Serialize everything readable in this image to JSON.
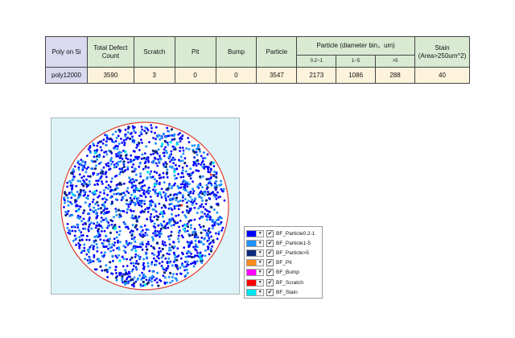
{
  "table": {
    "corner": "Poly on Si",
    "headers": {
      "total": "Total Defect Count",
      "scratch": "Scratch",
      "pit": "Pit",
      "bump": "Bump",
      "particle": "Particle",
      "particle_bin": "Particle (diameter bin，um)",
      "bin_1": "0.2~1",
      "bin_2": "1~5",
      "bin_3": ">5",
      "stain": "Stain (Area>250um^2)"
    },
    "row": {
      "label": "poly12000",
      "total": "3590",
      "scratch": "3",
      "pit": "0",
      "bump": "0",
      "particle": "3547",
      "bin_1": "2173",
      "bin_2": "1086",
      "bin_3": "288",
      "stain": "40"
    }
  },
  "colors": {
    "wafer_edge": "#e03b2e",
    "panel_bg": "#def3f7"
  },
  "legend": [
    {
      "label": "BF_Particle0.2-1",
      "color": "#0000ff",
      "checked": "✔"
    },
    {
      "label": "BF_Particle1-5",
      "color": "#1e90ff",
      "checked": "✔"
    },
    {
      "label": "BF_Particle>5",
      "color": "#0a2a7a",
      "checked": "✔"
    },
    {
      "label": "BF_Pit",
      "color": "#ff8c1a",
      "checked": "✔"
    },
    {
      "label": "BF_Bump",
      "color": "#ff00ff",
      "checked": "✔"
    },
    {
      "label": "BF_Scratch",
      "color": "#ff0000",
      "checked": "✔"
    },
    {
      "label": "BF_Stain",
      "color": "#00e5ee",
      "checked": "✔"
    }
  ]
}
